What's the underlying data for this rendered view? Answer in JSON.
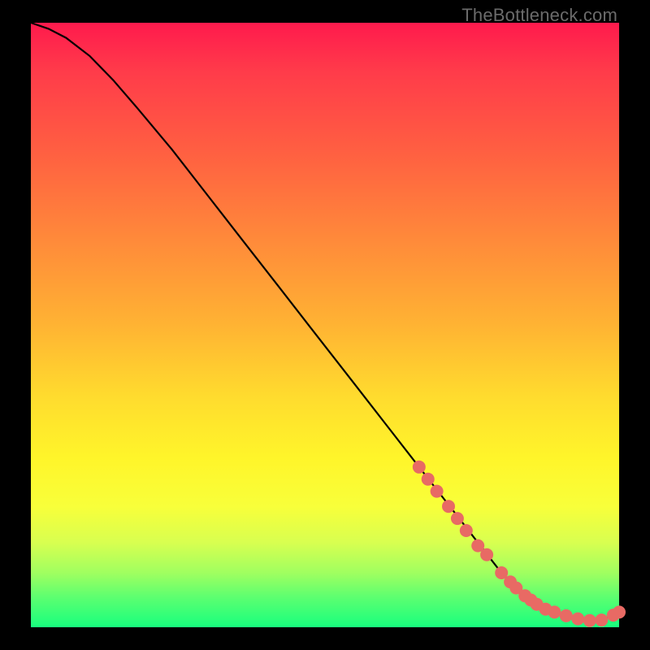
{
  "watermark": "TheBottleneck.com",
  "colors": {
    "curve": "#000000",
    "marker_fill": "#e86a64",
    "marker_stroke": "#cc4f49"
  },
  "chart_data": {
    "type": "line",
    "title": "",
    "xlabel": "",
    "ylabel": "",
    "xlim": [
      0,
      100
    ],
    "ylim": [
      0,
      100
    ],
    "series": [
      {
        "name": "bottleneck-curve",
        "x": [
          0,
          3,
          6,
          10,
          14,
          18,
          24,
          30,
          36,
          42,
          48,
          54,
          60,
          66,
          70,
          72,
          74,
          76,
          78,
          80,
          82,
          84,
          86,
          88,
          90,
          92,
          94,
          96,
          98,
          100
        ],
        "y": [
          100,
          99,
          97.5,
          94.5,
          90.5,
          86,
          79,
          71.5,
          64,
          56.5,
          49,
          41.5,
          34,
          26.5,
          21.5,
          19,
          16.5,
          14,
          11.5,
          9,
          7,
          5.3,
          3.9,
          2.8,
          2.0,
          1.4,
          1.1,
          1.1,
          1.6,
          2.5
        ]
      }
    ],
    "markers": {
      "name": "highlighted-points",
      "x": [
        66,
        67.5,
        69,
        71,
        72.5,
        74,
        76,
        77.5,
        80,
        81.5,
        82.5,
        84,
        85,
        86,
        87.5,
        89,
        91,
        93,
        95,
        97,
        99,
        100
      ],
      "y": [
        26.5,
        24.5,
        22.5,
        20,
        18,
        16,
        13.5,
        12,
        9,
        7.5,
        6.5,
        5.2,
        4.5,
        3.8,
        3.0,
        2.5,
        1.9,
        1.4,
        1.1,
        1.2,
        2.0,
        2.5
      ]
    }
  }
}
